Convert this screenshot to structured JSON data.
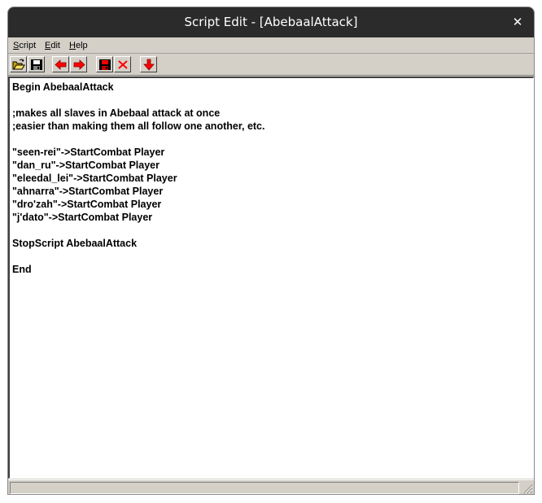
{
  "window": {
    "title": "Script Edit - [AbebaalAttack]",
    "close_glyph": "✕"
  },
  "menu": [
    {
      "label_first": "S",
      "label_rest": "cript"
    },
    {
      "label_first": "E",
      "label_rest": "dit"
    },
    {
      "label_first": "H",
      "label_rest": "elp"
    }
  ],
  "toolbar": {
    "buttons": [
      {
        "name": "open-folder-icon"
      },
      {
        "name": "save-disk-icon"
      },
      {
        "name": "arrow-left-icon"
      },
      {
        "name": "arrow-right-icon"
      },
      {
        "name": "save-red-disk-icon"
      },
      {
        "name": "delete-x-icon"
      },
      {
        "name": "arrow-down-icon"
      }
    ],
    "icon_color": "#ff0000"
  },
  "editor": {
    "lines": [
      "Begin AbebaalAttack",
      "",
      ";makes all slaves in Abebaal attack at once",
      ";easier than making them all follow one another, etc.",
      "",
      "\"seen-rei\"->StartCombat Player",
      "\"dan_ru\"->StartCombat Player",
      "\"eleedal_lei\"->StartCombat Player",
      "\"ahnarra\"->StartCombat Player",
      "\"dro'zah\"->StartCombat Player",
      "\"j'dato\"->StartCombat Player",
      "",
      "StopScript AbebaalAttack",
      "",
      "End"
    ]
  },
  "colors": {
    "titlebar": "#2b2b2b",
    "chrome": "#d4d0c8",
    "editor_bg": "#ffffff"
  }
}
